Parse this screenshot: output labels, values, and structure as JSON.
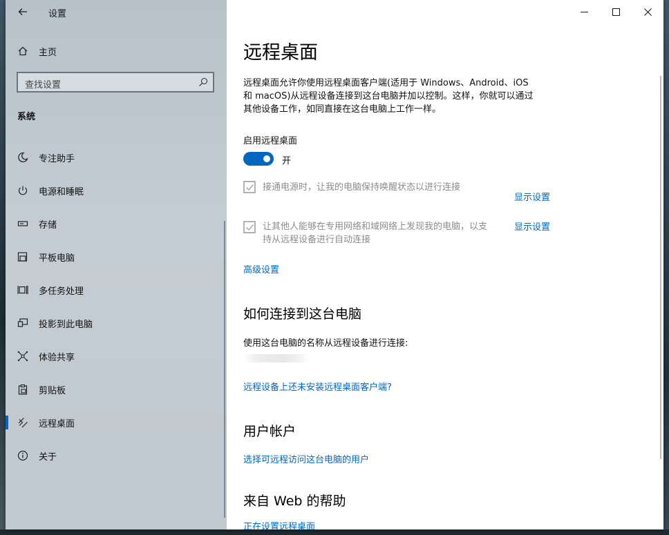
{
  "app": {
    "title": "设置"
  },
  "sidebar": {
    "home_label": "主页",
    "search_placeholder": "查找设置",
    "section_title": "系统",
    "items": [
      {
        "label": "专注助手",
        "icon": "moon-icon"
      },
      {
        "label": "电源和睡眠",
        "icon": "power-icon"
      },
      {
        "label": "存储",
        "icon": "storage-icon"
      },
      {
        "label": "平板电脑",
        "icon": "tablet-icon"
      },
      {
        "label": "多任务处理",
        "icon": "multitask-icon"
      },
      {
        "label": "投影到此电脑",
        "icon": "projecting-icon"
      },
      {
        "label": "体验共享",
        "icon": "shared-experiences-icon"
      },
      {
        "label": "剪贴板",
        "icon": "clipboard-icon"
      },
      {
        "label": "远程桌面",
        "icon": "remote-desktop-icon",
        "active": true
      },
      {
        "label": "关于",
        "icon": "info-icon"
      }
    ]
  },
  "content": {
    "title": "远程桌面",
    "description_line1": "远程桌面允许你使用远程桌面客户端(适用于 Windows、Android、iOS",
    "description_line2": "和 macOS)从远程设备连接到这台电脑并加以控制。这样，你就可以通过",
    "description_line3": "其他设备工作，如同直接在这台电脑上工作一样。",
    "enable_label": "启用远程桌面",
    "toggle_state": "开",
    "option1_label": "接通电源时，让我的电脑保持唤醒状态以进行连接",
    "option1_link": "显示设置",
    "option2_label_line1": "让其他人能够在专用网络和域网络上发现我的电脑，以支",
    "option2_label_line2": "持从远程设备进行自动连接",
    "option2_link": "显示设置",
    "advanced_link": "高级设置",
    "how_to_connect_title": "如何连接到这台电脑",
    "how_to_connect_desc": "使用这台电脑的名称从远程设备进行连接:",
    "no_client_link": "远程设备上还未安装远程桌面客户端?",
    "user_accounts_title": "用户帐户",
    "select_users_link": "选择可远程访问这台电脑的用户",
    "web_help_title": "来自 Web 的帮助",
    "setting_up_link": "正在设置远程桌面"
  },
  "colors": {
    "accent": "#0067c0",
    "sidebar_bg": "#c0c9cf",
    "disabled_text": "#8c8c8c"
  }
}
